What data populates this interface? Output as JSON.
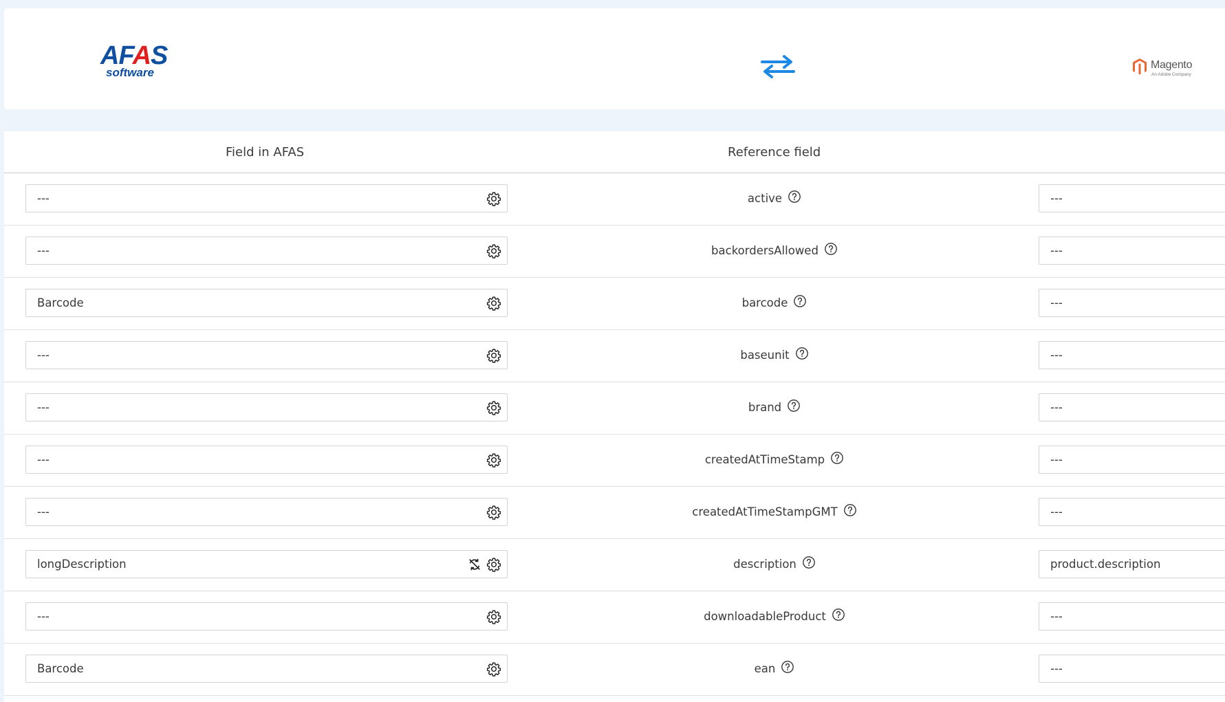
{
  "header": {
    "source_logo": {
      "word": "AFAS",
      "sub": "software"
    },
    "sync_icon": "bidirectional-arrows-icon",
    "target_logo": {
      "name": "Magento",
      "tagline": "An Adobe Company"
    }
  },
  "table": {
    "columns": {
      "source": "Field in AFAS",
      "reference": "Reference field"
    },
    "rows": [
      {
        "source": "---",
        "reference": "active",
        "target": "---",
        "reset": false
      },
      {
        "source": "---",
        "reference": "backordersAllowed",
        "target": "---",
        "reset": false
      },
      {
        "source": "Barcode",
        "reference": "barcode",
        "target": "---",
        "reset": false
      },
      {
        "source": "---",
        "reference": "baseunit",
        "target": "---",
        "reset": false
      },
      {
        "source": "---",
        "reference": "brand",
        "target": "---",
        "reset": false
      },
      {
        "source": "---",
        "reference": "createdAtTimeStamp",
        "target": "---",
        "reset": false
      },
      {
        "source": "---",
        "reference": "createdAtTimeStampGMT",
        "target": "---",
        "reset": false
      },
      {
        "source": "longDescription",
        "reference": "description",
        "target": "product.description",
        "reset": true
      },
      {
        "source": "---",
        "reference": "downloadableProduct",
        "target": "---",
        "reset": false
      },
      {
        "source": "Barcode",
        "reference": "ean",
        "target": "---",
        "reset": false
      }
    ]
  },
  "colors": {
    "accent": "#1e88e5",
    "afas_blue": "#0f4fa0",
    "afas_red": "#e02020",
    "magento_orange": "#ee672f"
  }
}
